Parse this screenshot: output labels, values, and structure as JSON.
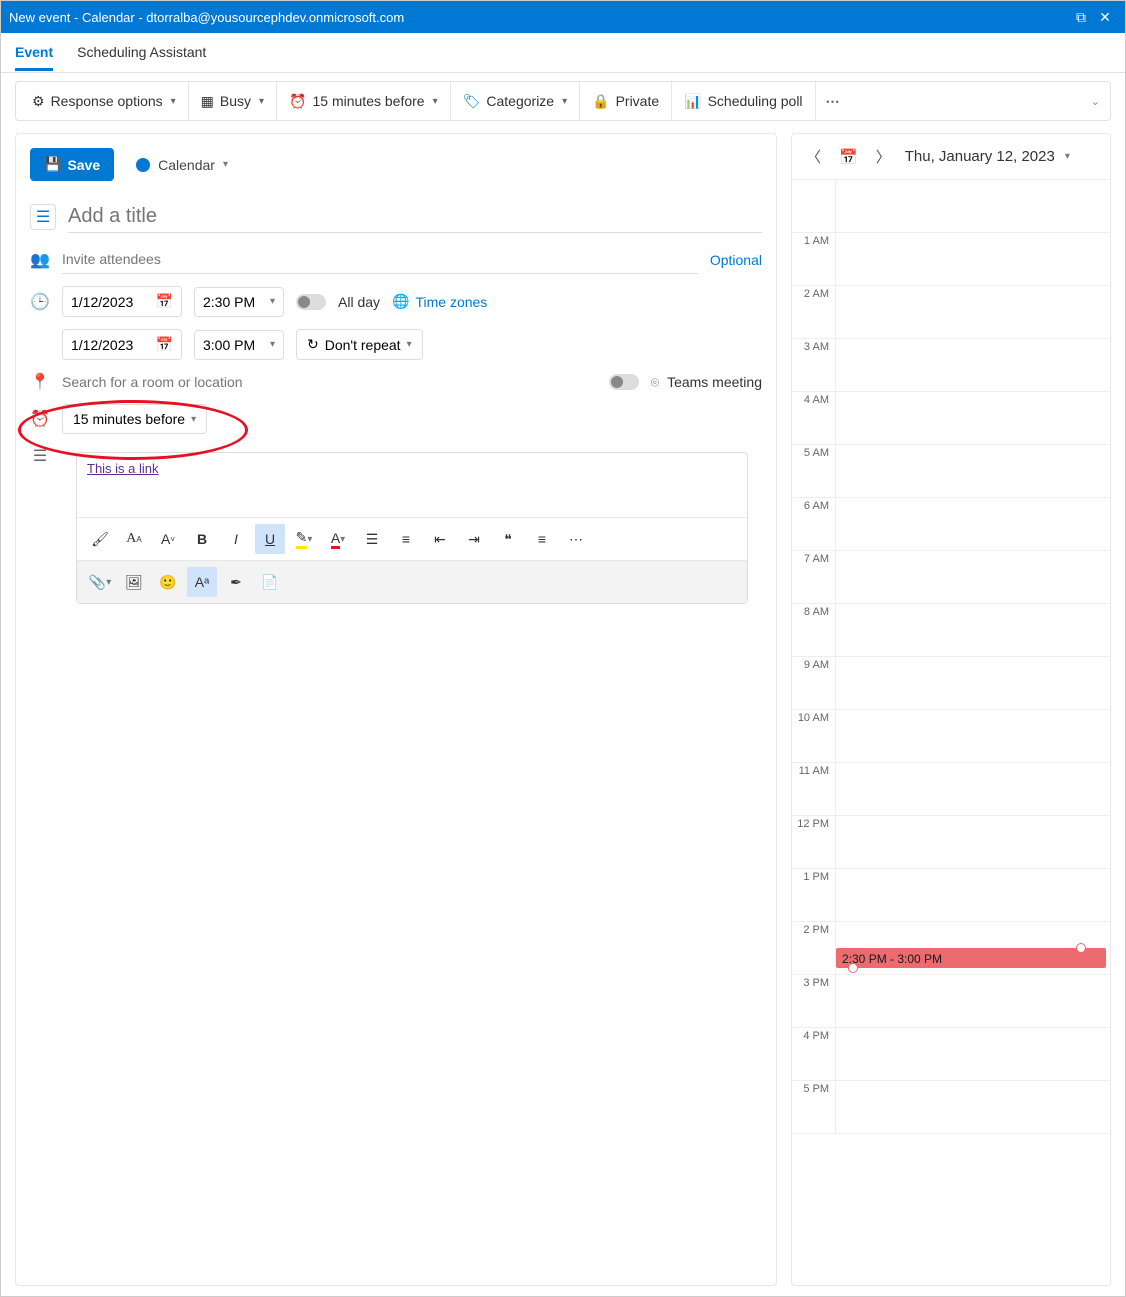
{
  "window": {
    "title": "New event - Calendar - dtorralba@yousourcephdev.onmicrosoft.com"
  },
  "tabs": {
    "event": "Event",
    "scheduling": "Scheduling Assistant",
    "active": "event"
  },
  "toolbar": {
    "response": "Response options",
    "busy": "Busy",
    "reminder": "15 minutes before",
    "categorize": "Categorize",
    "private": "Private",
    "poll": "Scheduling poll"
  },
  "form": {
    "save": "Save",
    "calendar": "Calendar",
    "title_placeholder": "Add a title",
    "attendees_placeholder": "Invite attendees",
    "optional": "Optional",
    "start_date": "1/12/2023",
    "start_time": "2:30 PM",
    "end_date": "1/12/2023",
    "end_time": "3:00 PM",
    "allday": "All day",
    "timezones": "Time zones",
    "repeat": "Don't repeat",
    "location_placeholder": "Search for a room or location",
    "teams": "Teams meeting",
    "reminder": "15 minutes before",
    "body_link": "This is a link"
  },
  "right": {
    "date": "Thu, January 12, 2023",
    "hours": [
      "",
      "1 AM",
      "2 AM",
      "3 AM",
      "4 AM",
      "5 AM",
      "6 AM",
      "7 AM",
      "8 AM",
      "9 AM",
      "10 AM",
      "11 AM",
      "12 PM",
      "1 PM",
      "2 PM",
      "3 PM",
      "4 PM",
      "5 PM"
    ],
    "event_label": "2:30 PM - 3:00 PM"
  }
}
